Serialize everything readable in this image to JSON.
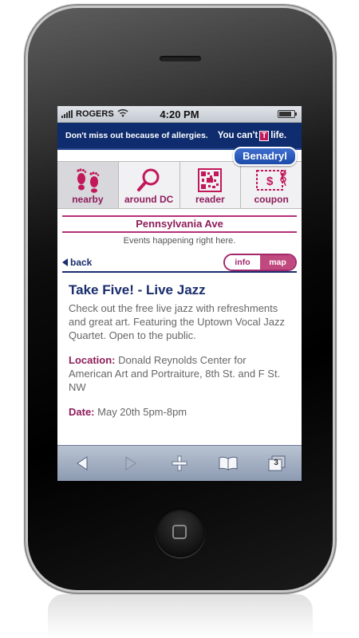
{
  "status": {
    "carrier": "ROGERS",
    "time": "4:20 PM",
    "battery_level": 0.85
  },
  "banner": {
    "tagline": "Don't miss out because of allergies.",
    "slogan_pre": "You can't",
    "slogan_mark": "T",
    "slogan_post": "life.",
    "brand": "Benadryl"
  },
  "nav": {
    "items": [
      {
        "label": "nearby",
        "icon": "footprints-icon",
        "active": true
      },
      {
        "label": "around DC",
        "icon": "magnifier-icon",
        "active": false
      },
      {
        "label": "reader",
        "icon": "barcode-icon",
        "active": false
      },
      {
        "label": "coupon",
        "icon": "coupon-scissors-icon",
        "active": false
      }
    ]
  },
  "section": {
    "title": "Pennsylvania Ave",
    "subtitle": "Events happening right here."
  },
  "back": {
    "label": "back"
  },
  "segments": {
    "info": "info",
    "map": "map",
    "selected": "map"
  },
  "event": {
    "title": "Take Five! - Live Jazz",
    "description": "Check out the free live jazz with refreshments and great art. Featuring the Uptown Vocal Jazz Quartet. Open to the public.",
    "location_label": "Location:",
    "location": "Donald Reynolds Center for American Art and Portraiture, 8th St. and F St. NW",
    "date_label": "Date:",
    "date": "May 20th 5pm-8pm"
  },
  "toolbar": {
    "tabs_count": "3"
  },
  "colors": {
    "accent": "#8e1d5a",
    "navy": "#1a2d6d",
    "banner": "#0f2d6e"
  }
}
